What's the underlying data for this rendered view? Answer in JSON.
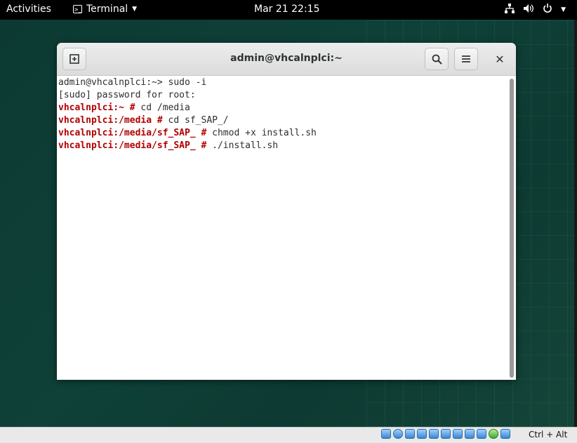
{
  "topbar": {
    "activities": "Activities",
    "app_name": "Terminal",
    "clock": "Mar 21  22:15"
  },
  "window": {
    "title": "admin@vhcalnplci:~"
  },
  "terminal": {
    "lines": [
      {
        "prompt": "",
        "text": "admin@vhcalnplci:~> sudo -i"
      },
      {
        "prompt": "",
        "text": "[sudo] password for root:"
      },
      {
        "prompt": "vhcalnplci:~ #",
        "text": " cd /media"
      },
      {
        "prompt": "vhcalnplci:/media #",
        "text": " cd sf_SAP_/"
      },
      {
        "prompt": "vhcalnplci:/media/sf_SAP_ #",
        "text": " chmod +x install.sh"
      },
      {
        "prompt": "vhcalnplci:/media/sf_SAP_ #",
        "text": " ./install.sh"
      }
    ]
  },
  "statusbar": {
    "host_key": "Ctrl + Alt"
  },
  "icons": {
    "network": "network-icon",
    "volume": "volume-icon",
    "power": "power-icon"
  }
}
